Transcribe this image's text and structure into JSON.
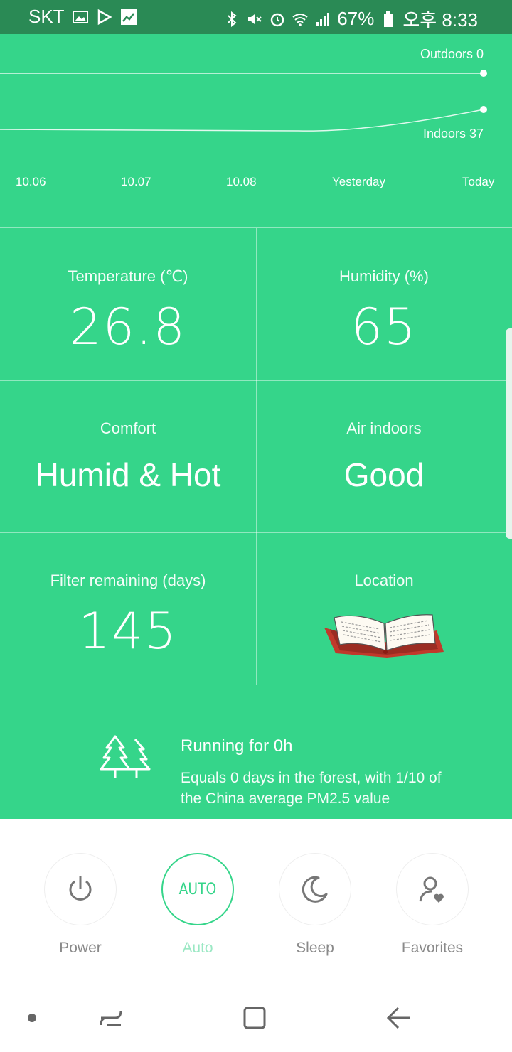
{
  "status_bar": {
    "carrier": "SKT",
    "battery": "67%",
    "time": "오후 8:33",
    "icons": [
      "image-icon",
      "play-store-icon",
      "stocks-icon",
      "bluetooth-icon",
      "mute-icon",
      "alarm-icon",
      "wifi-icon",
      "signal-icon",
      "battery-icon"
    ]
  },
  "chart_data": {
    "type": "line",
    "categories": [
      "10.06",
      "10.07",
      "10.08",
      "Yesterday",
      "Today"
    ],
    "series": [
      {
        "name": "Outdoors",
        "values": [
          0,
          0,
          0,
          0,
          0
        ]
      },
      {
        "name": "Indoors",
        "values": [
          null,
          null,
          null,
          null,
          37
        ]
      }
    ],
    "end_labels": {
      "outdoors": "Outdoors 0",
      "indoors": "Indoors 37"
    }
  },
  "stats": {
    "temperature": {
      "caption": "Temperature (℃)",
      "value": "26.8"
    },
    "humidity": {
      "caption": "Humidity (%)",
      "value": "65"
    },
    "comfort": {
      "caption": "Comfort",
      "value": "Humid & Hot"
    },
    "air": {
      "caption": "Air indoors",
      "value": "Good"
    },
    "filter": {
      "caption": "Filter remaining (days)",
      "value": "145"
    },
    "location": {
      "caption": "Location",
      "icon": "open-book-icon"
    }
  },
  "forest": {
    "title": "Running for 0h",
    "description": "Equals 0 days in the forest, with 1/10 of the China average PM2.5 value"
  },
  "controls": [
    {
      "id": "power",
      "label": "Power",
      "icon": "power-icon"
    },
    {
      "id": "auto",
      "label": "Auto",
      "icon_text": "AUTO",
      "active": true
    },
    {
      "id": "sleep",
      "label": "Sleep",
      "icon": "moon-icon"
    },
    {
      "id": "favorites",
      "label": "Favorites",
      "icon": "user-heart-icon"
    }
  ],
  "colors": {
    "accent_green": "#35d58a",
    "status_bar": "#2a8a55"
  }
}
